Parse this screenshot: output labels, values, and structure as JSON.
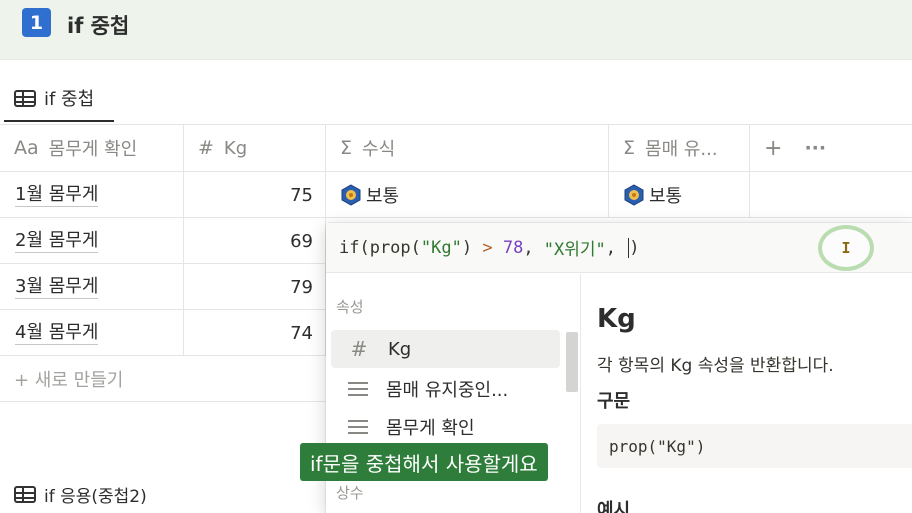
{
  "page": {
    "number_badge": "1",
    "title": "if 중첩"
  },
  "view_tab": {
    "label": "if 중첩"
  },
  "table": {
    "headers": [
      {
        "icon": "Aa",
        "label": "몸무게 확인"
      },
      {
        "icon": "#",
        "label": "Kg"
      },
      {
        "icon": "Σ",
        "label": "수식"
      },
      {
        "icon": "Σ",
        "label": "몸매 유..."
      }
    ],
    "add_column": "+",
    "more": "···",
    "rows": [
      {
        "name": "1월 몸무게",
        "kg": "75",
        "formula": "보통",
        "formula2": "보통"
      },
      {
        "name": "2월 몸무게",
        "kg": "69"
      },
      {
        "name": "3월 몸무게",
        "kg": "79"
      },
      {
        "name": "4월 몸무게",
        "kg": "74"
      }
    ],
    "new_row": "+ 새로 만들기"
  },
  "editor": {
    "formula": {
      "p1": "if(prop(",
      "s1": "\"Kg\"",
      "p2": ") ",
      "op": ">",
      "p3": " ",
      "n1": "78",
      "p4": ", ",
      "s2": "\"X위기\"",
      "p5": ", ",
      "p6": ")"
    },
    "cursor_glyph": "I",
    "section_properties": "속성",
    "items": [
      {
        "label": "Kg"
      },
      {
        "label": "몸매 유지중인..."
      },
      {
        "label": "몸무게 확인"
      }
    ],
    "section_constants": "상수",
    "doc": {
      "title": "Kg",
      "description": "각 항목의 Kg 속성을 반환합니다.",
      "syntax_heading": "구문",
      "syntax_code": "prop(\"Kg\")",
      "example_heading": "예시"
    }
  },
  "subtitle": "if문을 중첩해서 사용할게요",
  "view2": {
    "label": "if 응용(중첩2)"
  },
  "colors": {
    "accent": "#2f6fd0",
    "subtitle_bg": "#2e7d3a",
    "header_bg": "#eef4ec"
  }
}
